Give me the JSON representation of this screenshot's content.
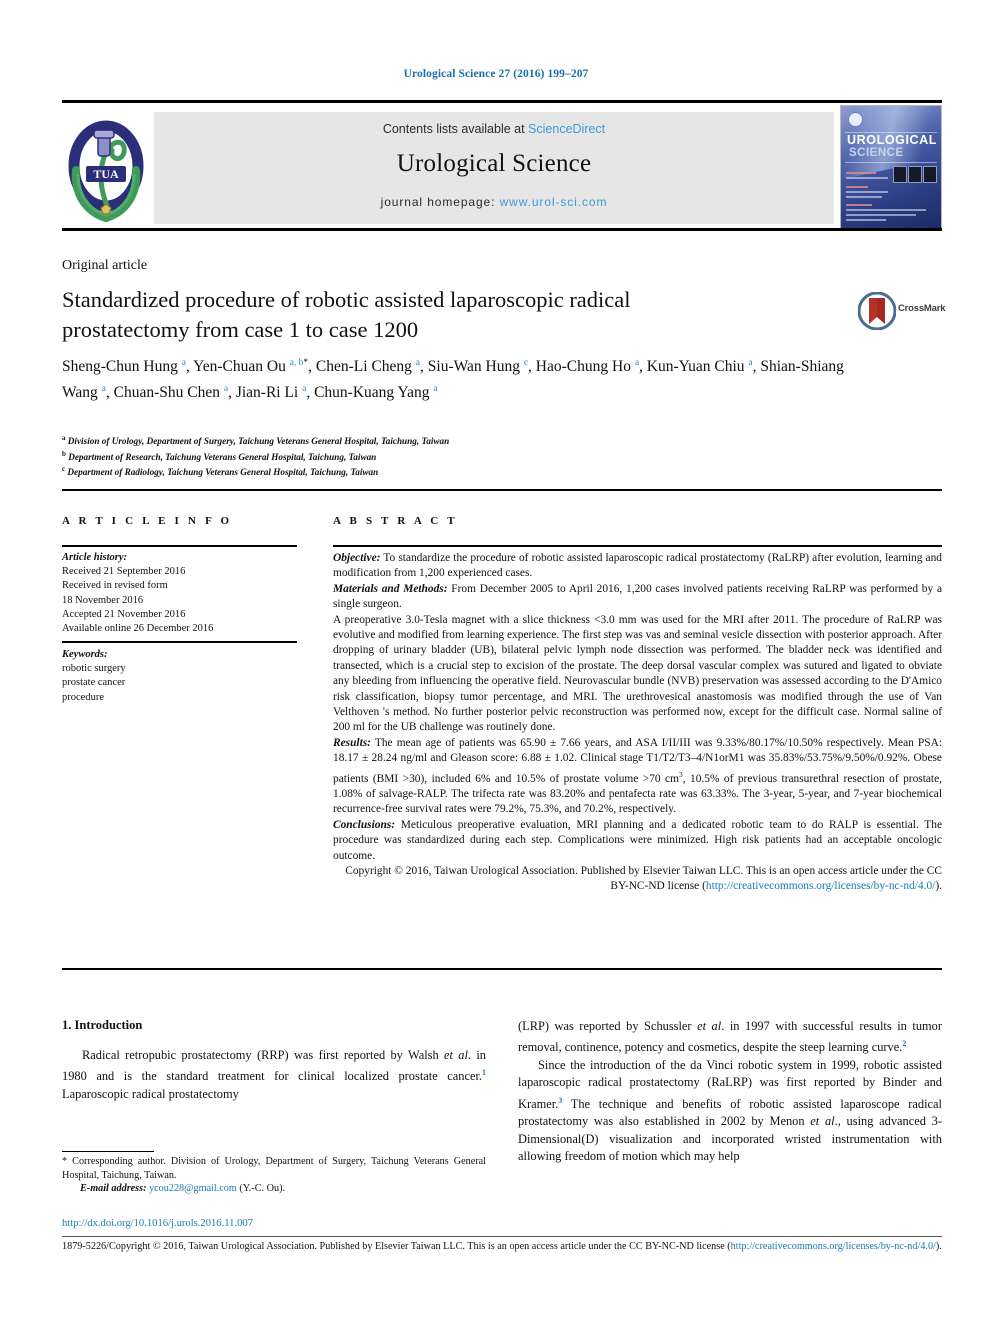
{
  "running_head": "Urological Science 27 (2016) 199–207",
  "masthead": {
    "contents_prefix": "Contents lists available at ",
    "sciencedirect": "ScienceDirect",
    "journal_title": "Urological Science",
    "homepage_prefix": "journal homepage: ",
    "homepage_url": "www.urol-sci.com",
    "logo_alt": "tua-logo",
    "cover_title_line1": "UROLOGICAL",
    "cover_title_line2": "SCIENCE"
  },
  "article": {
    "type_label": "Original article",
    "title": "Standardized procedure of robotic assisted laparoscopic radical prostatectomy from case 1 to case 1200",
    "crossmark_label": "CrossMark",
    "authors_html": "Sheng-Chun Hung <sup>a</sup>, Yen-Chuan Ou <sup>a, b</sup><sup class=\"star\">&#42;</sup>, Chen-Li Cheng <sup>a</sup>, Siu-Wan Hung <sup>c</sup>, Hao-Chung Ho <sup>a</sup>, Kun-Yuan Chiu <sup>a</sup>, Shian-Shiang Wang <sup>a</sup>, Chuan-Shu Chen <sup>a</sup>, Jian-Ri Li <sup>a</sup>, Chun-Kuang Yang <sup>a</sup>",
    "affiliations": [
      {
        "mark": "a",
        "text": "Division of Urology, Department of Surgery, Taichung Veterans General Hospital, Taichung, Taiwan"
      },
      {
        "mark": "b",
        "text": "Department of Research, Taichung Veterans General Hospital, Taichung, Taiwan"
      },
      {
        "mark": "c",
        "text": "Department of Radiology, Taichung Veterans General Hospital, Taichung, Taiwan"
      }
    ]
  },
  "info": {
    "header": "A R T I C L E  I N F O",
    "history_label": "Article history:",
    "history_lines": [
      "Received 21 September 2016",
      "Received in revised form",
      "18 November 2016",
      "Accepted 21 November 2016",
      "Available online 26 December 2016"
    ],
    "keywords_label": "Keywords:",
    "keywords": [
      "robotic surgery",
      "prostate cancer",
      "procedure"
    ]
  },
  "abstract": {
    "header": "A B S T R A C T",
    "objective_label": "Objective:",
    "objective_text": " To standardize the procedure of robotic assisted laparoscopic radical prostatectomy (RaLRP) after evolution, learning and modification from 1,200 experienced cases.",
    "materials_label": "Materials and Methods:",
    "materials_text": " From December 2005 to April 2016, 1,200 cases involved patients receiving RaLRP was performed by a single surgeon.",
    "methods_detail": "A preoperative 3.0-Tesla magnet with a slice thickness <3.0 mm was used for the MRI after 2011. The procedure of RaLRP was evolutive and modified from learning experience. The first step was vas and seminal vesicle dissection with posterior approach. After dropping of urinary bladder (UB), bilateral pelvic lymph node dissection was performed. The bladder neck was identified and transected, which is a crucial step to excision of the prostate. The deep dorsal vascular complex was sutured and ligated to obviate any bleeding from influencing the operative field. Neurovascular bundle (NVB) preservation was assessed according to the D'Amico risk classification, biopsy tumor percentage, and MRI. The urethrovesical anastomosis was modified through the use of Van Velthoven 's method. No further posterior pelvic reconstruction was performed now, except for the difficult case. Normal saline of 200 ml for the UB challenge was routinely done.",
    "results_label": "Results:",
    "results_text_pre": " The mean age of patients was 65.90 ± 7.66 years, and ASA I/II/III was 9.33%/80.17%/10.50% respectively. Mean PSA: 18.17 ± 28.24 ng/ml and Gleason score: 6.88 ± 1.02. Clinical stage T1/T2/T3–4/N1orM1 was 35.83%/53.75%/9.50%/0.92%. Obese patients (BMI >30), included 6% and 10.5% of prostate volume >70 cm",
    "results_sup": "3",
    "results_text_post": ", 10.5% of previous transurethral resection of prostate, 1.08% of salvage-RALP. The trifecta rate was 83.20% and pentafecta rate was 63.33%. The 3-year, 5-year, and 7-year biochemical recurrence-free survival rates were 79.2%, 75.3%, and 70.2%, respectively.",
    "conclusions_label": "Conclusions:",
    "conclusions_text": " Meticulous preoperative evaluation, MRI planning and a dedicated robotic team to do RALP is essential. The procedure was standardized during each step. Complications were minimized. High risk patients had an acceptable oncologic outcome.",
    "copyright_text": "Copyright © 2016, Taiwan Urological Association. Published by Elsevier Taiwan LLC. This is an open access article under the CC BY-NC-ND license (",
    "copyright_link": "http://creativecommons.org/licenses/by-nc-nd/4.0/",
    "copyright_tail": ")."
  },
  "body": {
    "intro_heading": "1. Introduction",
    "left_para1_html": "Radical retropubic prostatectomy (RRP) was first reported by Walsh <i>et al</i>. in 1980 and is the standard treatment for clinical localized prostate cancer.<sup>1</sup> Laparoscopic radical prostatectomy",
    "right_para1_html": "(LRP) was reported by Schussler <i>et al</i>. in 1997 with successful results in tumor removal, continence, potency and cosmetics, despite the steep learning curve.<sup>2</sup>",
    "right_para2_html": "Since the introduction of the da Vinci robotic system in 1999, robotic assisted laparoscopic radical prostatectomy (RaLRP) was first reported by Binder and Kramer.<sup>3</sup> The technique and benefits of robotic assisted laparoscope radical prostatectomy was also established in 2002 by Menon <i>et al</i>., using advanced 3-Dimensional(D) visualization and incorporated wristed instrumentation with allowing freedom of motion which may help"
  },
  "footnote": {
    "corresponding_html": "&#42; Corresponding author. Division of Urology, Department of Surgery, Taichung Veterans General Hospital, Taichung, Taiwan.",
    "email_label": "E-mail address:",
    "email": "ycou228@gmail.com",
    "email_suffix": " (Y.-C. Ou).",
    "doi": "http://dx.doi.org/10.1016/j.urols.2016.11.007",
    "bottom_copyright_pre": "1879-5226/Copyright © 2016, Taiwan Urological Association. Published by Elsevier Taiwan LLC. This is an open access article under the CC BY-NC-ND license (",
    "bottom_copyright_link": "http://creativecommons.org/licenses/by-nc-nd/4.0/",
    "bottom_copyright_tail": ")."
  },
  "colors": {
    "link": "#1a7ab5",
    "sciencedirect": "#3c9ad6",
    "running_head": "#1a6fa8",
    "masthead_bg": "#e6e6e6",
    "crossmark_red": "#b5342a",
    "crossmark_ring": "#4a6e8f"
  }
}
